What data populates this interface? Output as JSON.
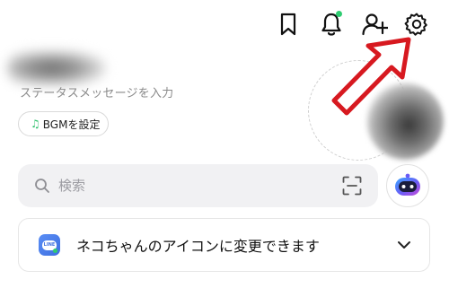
{
  "header": {
    "icons": [
      "bookmark-icon",
      "bell-icon",
      "add-friend-icon",
      "gear-icon"
    ],
    "accent_green": "#2ecc71",
    "arrow_color": "#d71920"
  },
  "profile": {
    "status_message_placeholder": "ステータスメッセージを入力",
    "bgm_button_label": "BGMを設定"
  },
  "search": {
    "placeholder": "検索"
  },
  "notice": {
    "text": "ネコちゃんのアイコンに変更できます"
  }
}
